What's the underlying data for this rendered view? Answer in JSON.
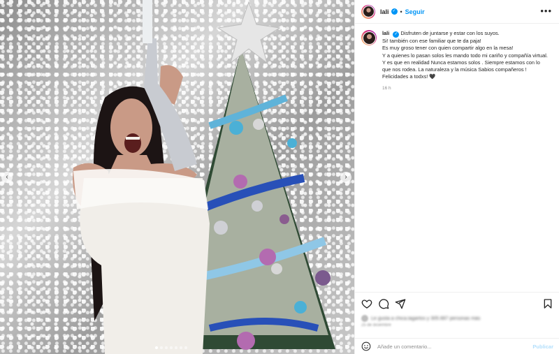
{
  "post": {
    "username": "lali",
    "separator": "•",
    "follow_label": "Seguir",
    "more_label": "•••",
    "caption_lines": [
      "Disfruten de juntarse y estar con los suyos.",
      "Si! también con ese familiar que te da paja!",
      "Es muy groso tener con quien compartir algo en la mesa!",
      "Y a quienes lo pasan solos les mando todo mi cariño y compañía virtual. Y es que en realidad Nunca estamos solos . Siempre estamos con lo que nos rodea. La naturaleza y la música Sabios compañeros !",
      "Felicidades a todxs! 🖤"
    ],
    "time": "16 h",
    "likes_text": "Le gusta a chica.lagartos y 305.687 personas más",
    "date_text": "25 de diciembre",
    "comment_placeholder": "Añade un comentario...",
    "publish_label": "Publicar"
  },
  "icons": [
    "verified-icon",
    "more-icon",
    "heart-icon",
    "comment-icon",
    "share-icon",
    "bookmark-icon",
    "emoji-icon",
    "chevron-left-icon",
    "chevron-right-icon"
  ],
  "colors": {
    "accent": "#0095f6",
    "publish_disabled": "#b2dffc",
    "muted": "#8e8e8e",
    "border": "#efefef"
  },
  "carousel": {
    "slides": 7,
    "active": 1
  }
}
